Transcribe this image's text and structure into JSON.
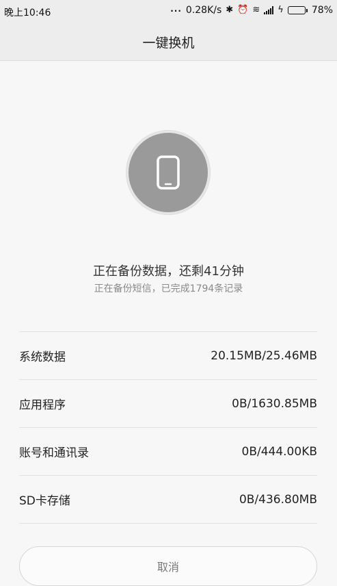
{
  "status_bar": {
    "time": "晚上10:46",
    "dots": "...",
    "network_speed": "0.28K/s",
    "bluetooth_icon": "✱",
    "alarm_icon": "⏰",
    "wifi_icon": "≋",
    "charging_icon": "ϟ",
    "battery_percent": "78%",
    "battery_level": 0.78,
    "battery_color": "#22c33a"
  },
  "header": {
    "title": "一键换机"
  },
  "progress": {
    "icon": "phone-icon",
    "main_status": "正在备份数据，还剩41分钟",
    "sub_status": "正在备份短信，已完成1794条记录"
  },
  "items": [
    {
      "label": "系统数据",
      "value": "20.15MB/25.46MB"
    },
    {
      "label": "应用程序",
      "value": "0B/1630.85MB"
    },
    {
      "label": "账号和通讯录",
      "value": "0B/444.00KB"
    },
    {
      "label": "SD卡存储",
      "value": "0B/436.80MB"
    }
  ],
  "actions": {
    "cancel_label": "取消"
  }
}
